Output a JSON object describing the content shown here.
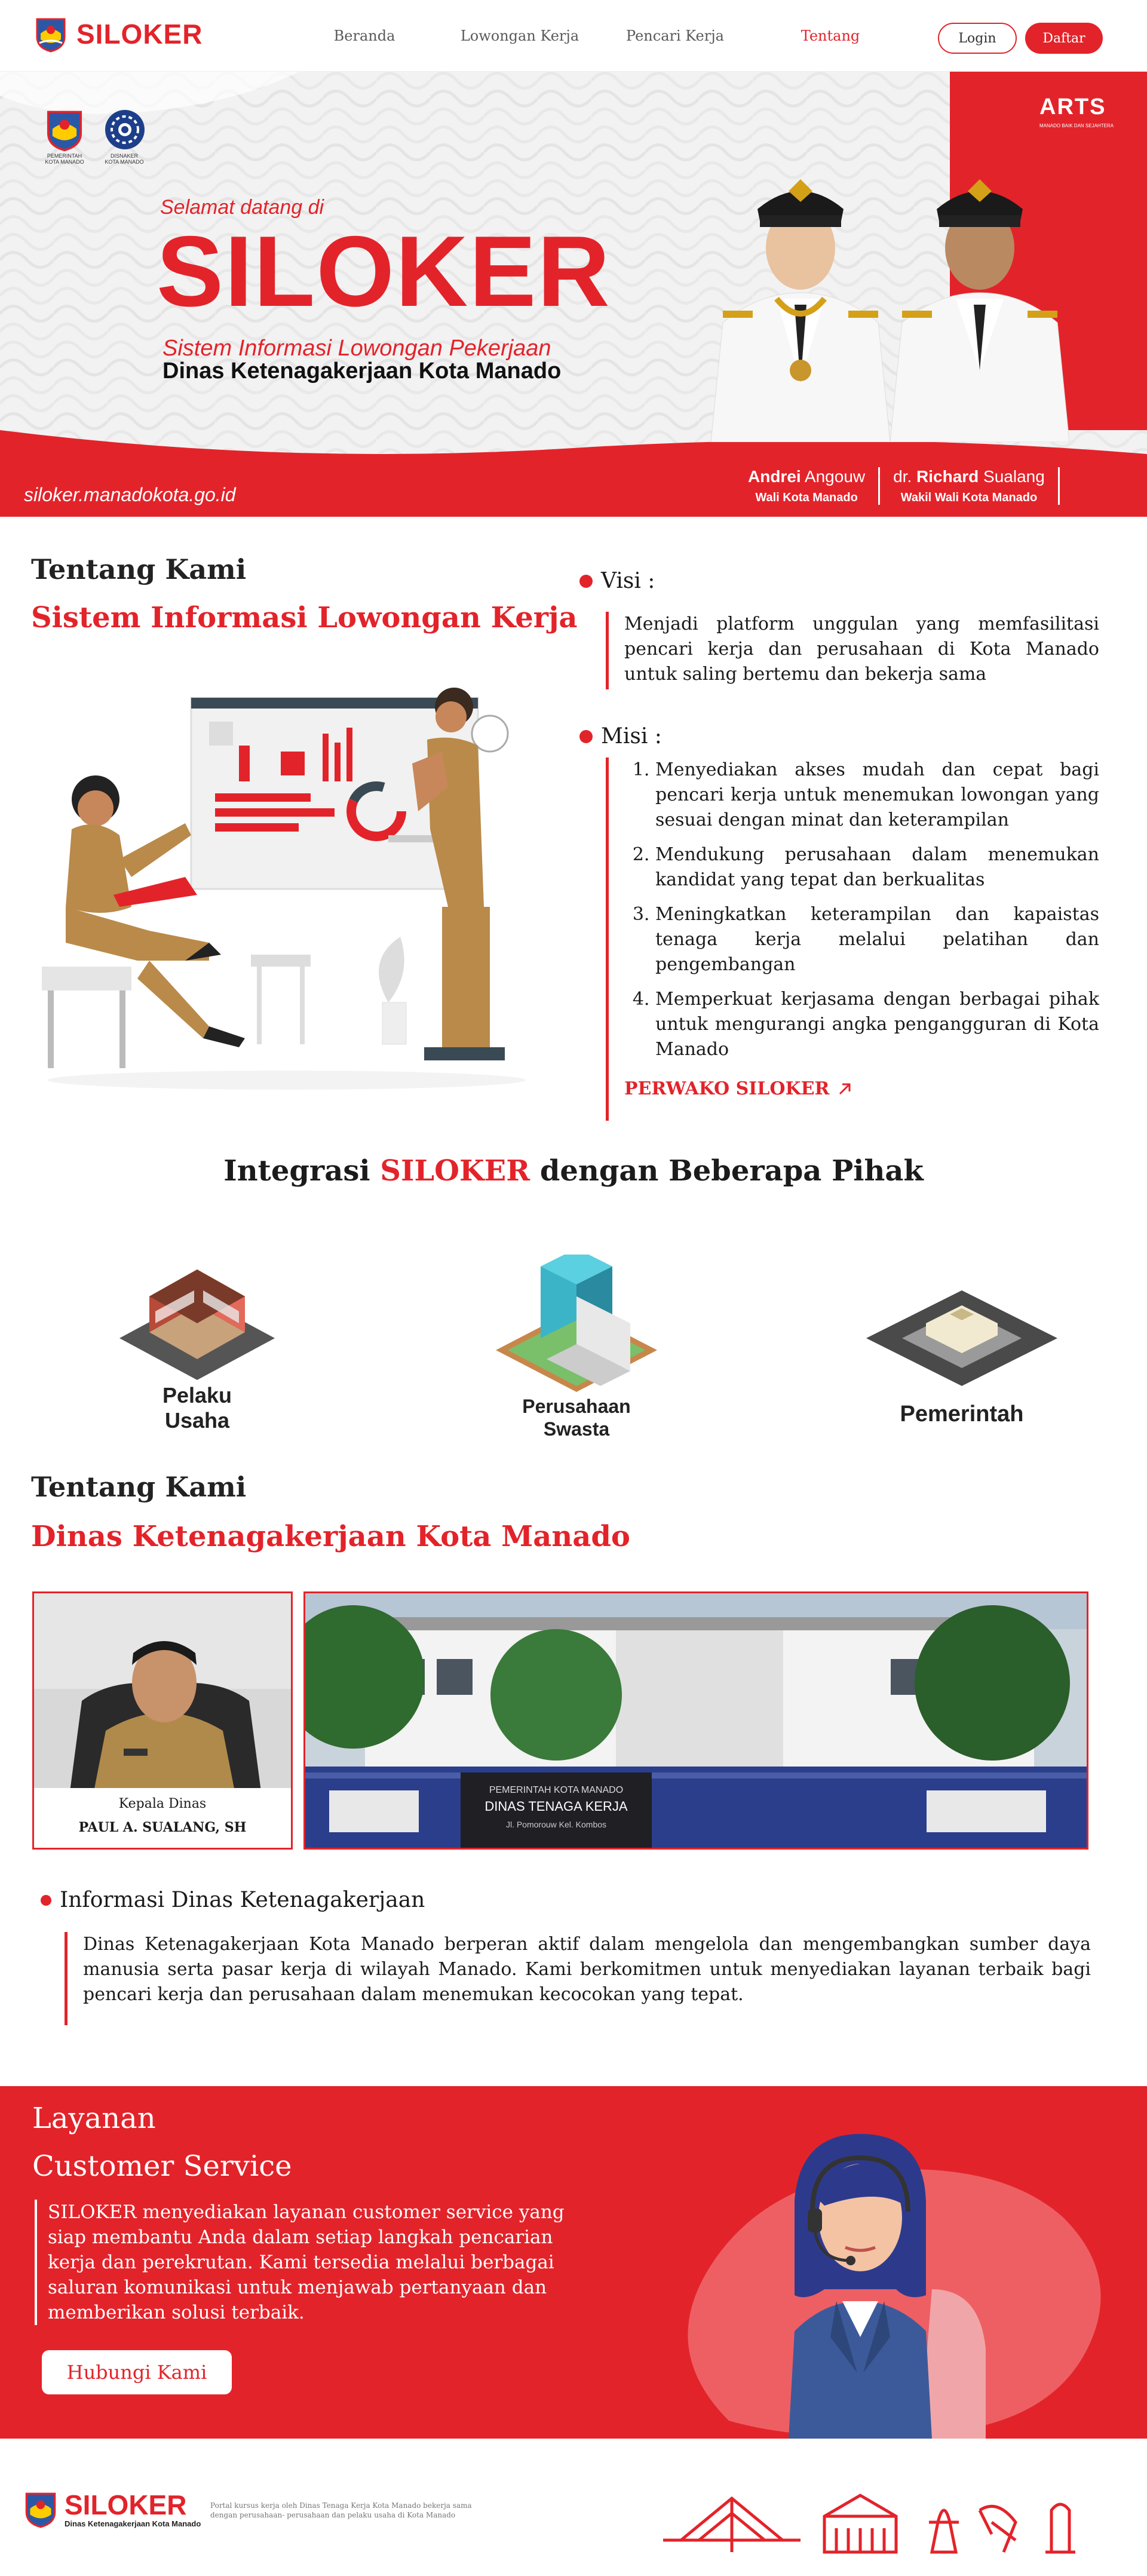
{
  "nav": {
    "brand": "SILOKER",
    "links": [
      "Beranda",
      "Lowongan Kerja",
      "Pencari Kerja",
      "Tentang"
    ],
    "active_index": 3,
    "login": "Login",
    "daftar": "Daftar"
  },
  "hero": {
    "logo1_caption": "PEMERINTAH KOTA MANADO",
    "logo2_caption": "DISNAKER KOTA MANADO",
    "welcome": "Selamat datang di",
    "title": "SILOKER",
    "subtitle_line1": "Sistem Informasi Lowongan Pekerjaan",
    "subtitle_line2": "Dinas Ketenagakerjaan Kota Manado",
    "url": "siloker.manadokota.go.id",
    "arts": "ARTS",
    "arts_small": "MANADO BAIK DAN SEJAHTERA",
    "official1_first": "Andrei",
    "official1_last": " Angouw",
    "official1_role": "Wali Kota Manado",
    "official2_prefix": "dr. ",
    "official2_first": "Richard",
    "official2_last": " Sualang",
    "official2_role": "Wakil Wali Kota Manado"
  },
  "about": {
    "heading": "Tentang Kami",
    "subheading": "Sistem Informasi Lowongan Kerja",
    "visi_label": "Visi :",
    "visi_text": "Menjadi platform unggulan yang memfasilitasi pencari kerja dan perusahaan di Kota Manado untuk saling bertemu dan bekerja sama",
    "misi_label": "Misi :",
    "misi": [
      "Menyediakan akses mudah dan cepat bagi pencari kerja untuk menemukan lowongan yang sesuai dengan minat dan keterampilan",
      "Mendukung perusahaan dalam menemukan kandidat yang tepat dan berkualitas",
      "Meningkatkan keterampilan dan kapaistas tenaga kerja melalui pelatihan dan pengembangan",
      "Memperkuat kerjasama dengan berbagai pihak untuk mengurangi angka pengangguran di Kota Manado"
    ],
    "perwako": "PERWAKO SILOKER"
  },
  "integration": {
    "title_pre": "Integrasi ",
    "title_red": "SILOKER",
    "title_post": " dengan Beberapa Pihak",
    "partners": [
      {
        "line1": "Pelaku",
        "line2": "Usaha"
      },
      {
        "line1": "Perusahaan",
        "line2": "Swasta"
      },
      {
        "line1": "Pemerintah",
        "line2": ""
      }
    ]
  },
  "dinas": {
    "heading": "Tentang Kami",
    "subheading": "Dinas Ketenagakerjaan Kota Manado",
    "head_role": "Kepala Dinas",
    "head_name": "PAUL A. SUALANG, SH",
    "building_sign1": "PEMERINTAH KOTA MANADO",
    "building_sign2": "DINAS TENAGA KERJA",
    "building_sign3": "Jl. Pomorouw Kel. Kombos",
    "info_label": "Informasi Dinas Ketenagakerjaan",
    "info_text": "Dinas Ketenagakerjaan Kota Manado berperan aktif dalam mengelola dan mengembangkan sumber daya manusia serta pasar kerja di wilayah Manado. Kami berkomitmen untuk menyediakan layanan terbaik bagi pencari kerja dan perusahaan dalam menemukan kecocokan yang tepat."
  },
  "service": {
    "label": "Layanan",
    "title": "Customer Service",
    "text": "SILOKER menyediakan layanan customer service yang siap membantu Anda dalam setiap langkah pencarian kerja dan perekrutan. Kami tersedia melalui berbagai saluran komunikasi untuk menjawab pertanyaan dan memberikan solusi terbaik.",
    "button": "Hubungi Kami"
  },
  "footer": {
    "brand": "SILOKER",
    "brand_sub": "Dinas Ketenagakerjaan Kota Manado",
    "desc": "Portal kursus kerja oleh Dinas Tenaga Kerja Kota Manado bekerja sama dengan perusahaan- perusahaan dan pelaku usaha di Kota Manado"
  },
  "colors": {
    "accent": "#e3232a",
    "text": "#1b1b1b",
    "white": "#ffffff"
  }
}
